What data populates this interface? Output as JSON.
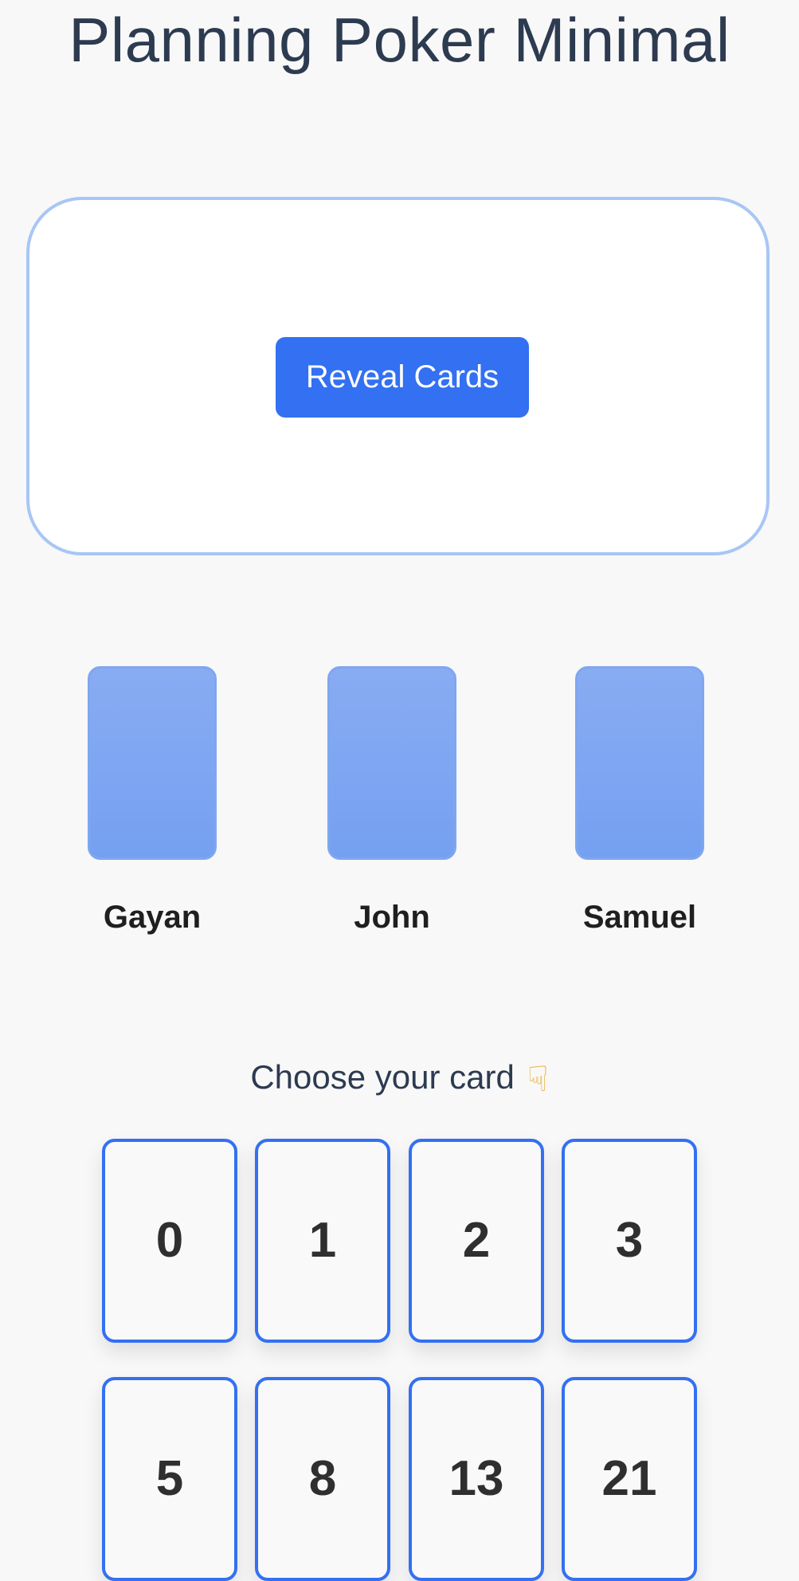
{
  "app": {
    "title": "Planning Poker Minimal"
  },
  "table": {
    "reveal_button_label": "Reveal Cards"
  },
  "players": [
    {
      "name": "Gayan"
    },
    {
      "name": "John"
    },
    {
      "name": "Samuel"
    }
  ],
  "deck": {
    "prompt": "Choose your card",
    "prompt_icon": "pointing-down-hand-icon",
    "cards": [
      "0",
      "1",
      "2",
      "3",
      "5",
      "8",
      "13",
      "21"
    ]
  },
  "colors": {
    "accent": "#3370f2",
    "table_border": "#a8c6f5",
    "player_card": "#7fa6f0",
    "title_text": "#2d3b50",
    "background": "#f8f8f8"
  }
}
